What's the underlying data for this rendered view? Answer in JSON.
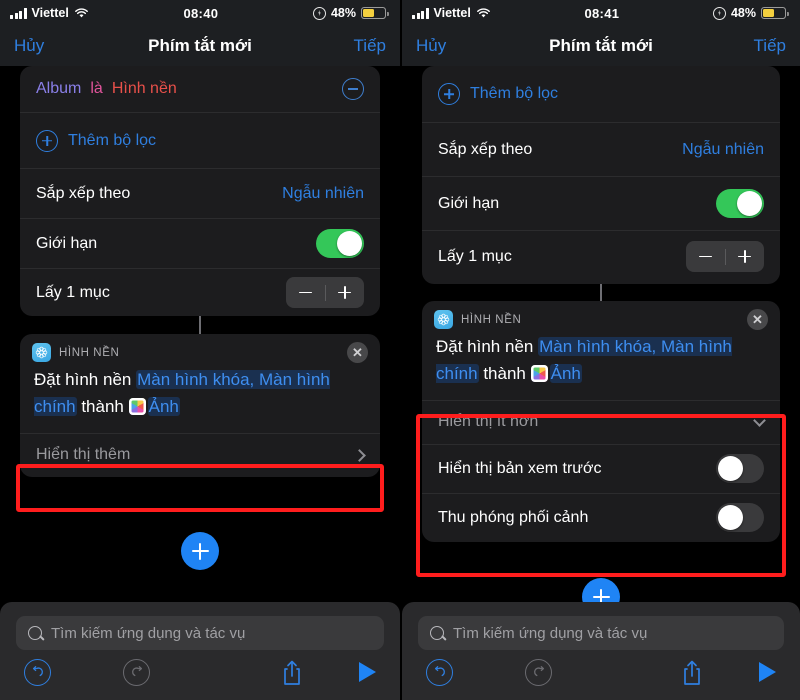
{
  "screens": [
    {
      "id": "left",
      "status": {
        "carrier": "Viettel",
        "time": "08:40",
        "battery_pct": "48%",
        "wifi_icon": "wifi-icon",
        "signal_icon": "signal-bars-icon",
        "lowpower_icon": "low-power-icon",
        "battery_icon": "battery-icon"
      },
      "nav": {
        "cancel": "Hủy",
        "title": "Phím tắt mới",
        "next": "Tiếp"
      },
      "filter_row": {
        "field": "Album",
        "operator": "là",
        "value": "Hình nền",
        "remove_icon": "minus-circle-icon"
      },
      "add_filter": {
        "label": "Thêm bộ lọc",
        "icon": "plus-circle-icon"
      },
      "sort": {
        "label": "Sắp xếp theo",
        "value": "Ngẫu nhiên"
      },
      "limit": {
        "label": "Giới hạn",
        "toggle_state": "on"
      },
      "count": {
        "label": "Lấy 1 mục",
        "minus_icon": "minus-icon",
        "plus_icon": "plus-icon"
      },
      "action": {
        "app": "HÌNH NỀN",
        "app_icon": "wallpaper-icon",
        "close_icon": "close-icon",
        "text_1": "Đặt hình nền",
        "param_1": "Màn hình khóa, Màn hình chính",
        "text_2": "thành",
        "param_2": "Ảnh",
        "photos_icon": "photos-icon"
      },
      "disclosure": {
        "label": "Hiển thị thêm",
        "icon": "chevron-right-icon"
      },
      "add_button": {
        "icon": "plus-icon"
      },
      "search": {
        "placeholder": "Tìm kiếm ứng dụng và tác vụ",
        "icon": "search-icon"
      },
      "toolbar": {
        "undo_icon": "undo-icon",
        "redo_icon": "redo-icon",
        "share_icon": "share-icon",
        "play_icon": "play-icon"
      }
    },
    {
      "id": "right",
      "status": {
        "carrier": "Viettel",
        "time": "08:41",
        "battery_pct": "48%",
        "wifi_icon": "wifi-icon",
        "signal_icon": "signal-bars-icon",
        "lowpower_icon": "low-power-icon",
        "battery_icon": "battery-icon"
      },
      "nav": {
        "cancel": "Hủy",
        "title": "Phím tắt mới",
        "next": "Tiếp"
      },
      "add_filter": {
        "label": "Thêm bộ lọc",
        "icon": "plus-circle-icon"
      },
      "sort": {
        "label": "Sắp xếp theo",
        "value": "Ngẫu nhiên"
      },
      "limit": {
        "label": "Giới hạn",
        "toggle_state": "on"
      },
      "count": {
        "label": "Lấy 1 mục",
        "minus_icon": "minus-icon",
        "plus_icon": "plus-icon"
      },
      "action": {
        "app": "HÌNH NỀN",
        "app_icon": "wallpaper-icon",
        "close_icon": "close-icon",
        "text_1": "Đặt hình nền",
        "param_1": "Màn hình khóa, Màn hình chính",
        "text_2": "thành",
        "param_2": "Ảnh",
        "photos_icon": "photos-icon"
      },
      "disclosure": {
        "label": "Hiển thị ít hơn",
        "icon": "chevron-down-icon"
      },
      "options": [
        {
          "label": "Hiển thị bản xem trước",
          "toggle_state": "off"
        },
        {
          "label": "Thu phóng phối cảnh",
          "toggle_state": "off"
        }
      ],
      "add_button": {
        "icon": "plus-icon"
      },
      "search": {
        "placeholder": "Tìm kiếm ứng dụng và tác vụ",
        "icon": "search-icon"
      },
      "toolbar": {
        "undo_icon": "undo-icon",
        "redo_icon": "redo-icon",
        "share_icon": "share-icon",
        "play_icon": "play-icon"
      }
    }
  ],
  "colors": {
    "accent_blue": "#2f7fe0",
    "toggle_on": "#34c759",
    "highlight_red": "#ff1d1d",
    "battery_yellow": "#f4d03f"
  }
}
